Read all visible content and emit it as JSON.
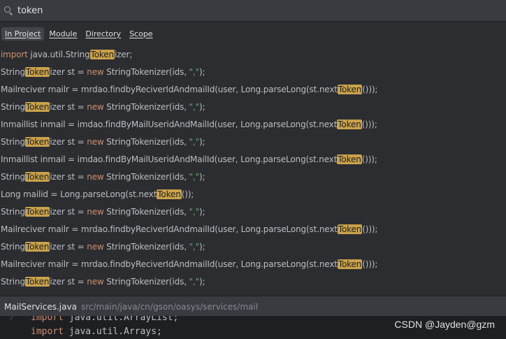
{
  "search": {
    "query": "token"
  },
  "scope_tabs": [
    {
      "label": "In Project",
      "active": true
    },
    {
      "label": "Module",
      "active": false
    },
    {
      "label": "Directory",
      "active": false
    },
    {
      "label": "Scope",
      "active": false
    }
  ],
  "results": [
    [
      [
        "kw",
        "import "
      ],
      [
        "t",
        "java.util.String"
      ],
      [
        "hl",
        "Token"
      ],
      [
        "t",
        "izer;"
      ]
    ],
    [
      [
        "t",
        "String"
      ],
      [
        "hl",
        "Token"
      ],
      [
        "t",
        "izer st = "
      ],
      [
        "kw",
        "new "
      ],
      [
        "t",
        "StringTokenizer(ids, "
      ],
      [
        "str",
        "\",\""
      ],
      [
        "t",
        ");"
      ]
    ],
    [
      [
        "t",
        "Mailreciver mailr = mrdao.findbyReciverIdAndmailId(user, Long.parseLong(st.next"
      ],
      [
        "hl",
        "Token"
      ],
      [
        "t",
        "()));"
      ]
    ],
    [
      [
        "t",
        "String"
      ],
      [
        "hl",
        "Token"
      ],
      [
        "t",
        "izer st = "
      ],
      [
        "kw",
        "new "
      ],
      [
        "t",
        "StringTokenizer(ids, "
      ],
      [
        "str",
        "\",\""
      ],
      [
        "t",
        ");"
      ]
    ],
    [
      [
        "t",
        "Inmaillist inmail = imdao.findByMailUseridAndMailId(user, Long.parseLong(st.next"
      ],
      [
        "hl",
        "Token"
      ],
      [
        "t",
        "()));"
      ]
    ],
    [
      [
        "t",
        "String"
      ],
      [
        "hl",
        "Token"
      ],
      [
        "t",
        "izer st = "
      ],
      [
        "kw",
        "new "
      ],
      [
        "t",
        "StringTokenizer(ids, "
      ],
      [
        "str",
        "\",\""
      ],
      [
        "t",
        ");"
      ]
    ],
    [
      [
        "t",
        "Inmaillist inmail = imdao.findByMailUseridAndMailId(user, Long.parseLong(st.next"
      ],
      [
        "hl",
        "Token"
      ],
      [
        "t",
        "()));"
      ]
    ],
    [
      [
        "t",
        "String"
      ],
      [
        "hl",
        "Token"
      ],
      [
        "t",
        "izer st = "
      ],
      [
        "kw",
        "new "
      ],
      [
        "t",
        "StringTokenizer(ids, "
      ],
      [
        "str",
        "\",\""
      ],
      [
        "t",
        ");"
      ]
    ],
    [
      [
        "t",
        "Long mailid = Long.parseLong(st.next"
      ],
      [
        "hl",
        "Token"
      ],
      [
        "t",
        "());"
      ]
    ],
    [
      [
        "t",
        "String"
      ],
      [
        "hl",
        "Token"
      ],
      [
        "t",
        "izer st = "
      ],
      [
        "kw",
        "new "
      ],
      [
        "t",
        "StringTokenizer(ids, "
      ],
      [
        "str",
        "\",\""
      ],
      [
        "t",
        ");"
      ]
    ],
    [
      [
        "t",
        "Mailreciver mailr = mrdao.findbyReciverIdAndmailId(user, Long.parseLong(st.next"
      ],
      [
        "hl",
        "Token"
      ],
      [
        "t",
        "()));"
      ]
    ],
    [
      [
        "t",
        "String"
      ],
      [
        "hl",
        "Token"
      ],
      [
        "t",
        "izer st = "
      ],
      [
        "kw",
        "new "
      ],
      [
        "t",
        "StringTokenizer(ids, "
      ],
      [
        "str",
        "\",\""
      ],
      [
        "t",
        ");"
      ]
    ],
    [
      [
        "t",
        "Mailreciver mailr = mrdao.findbyReciverIdAndmailId(user, Long.parseLong(st.next"
      ],
      [
        "hl",
        "Token"
      ],
      [
        "t",
        "()));"
      ]
    ],
    [
      [
        "t",
        "String"
      ],
      [
        "hl",
        "Token"
      ],
      [
        "t",
        "izer st = "
      ],
      [
        "kw",
        "new "
      ],
      [
        "t",
        "StringTokenizer(ids, "
      ],
      [
        "str",
        "\",\""
      ],
      [
        "t",
        ");"
      ]
    ]
  ],
  "path_bar": {
    "file": "MailServices.java",
    "directory": "src/main/java/cn/gson/oasys/services/mail"
  },
  "editor": {
    "lines": [
      {
        "number": "7",
        "keyword": "import",
        "rest": " java.util.ArrayList;"
      },
      {
        "number": "",
        "keyword": "import",
        "rest": " java.util.Arrays;"
      }
    ]
  },
  "watermark": "CSDN @Jayden@gzm",
  "colors": {
    "highlight": "#caa24a",
    "keyword": "#cf8e6d",
    "string": "#6aab73",
    "panel": "#2b2d30"
  }
}
